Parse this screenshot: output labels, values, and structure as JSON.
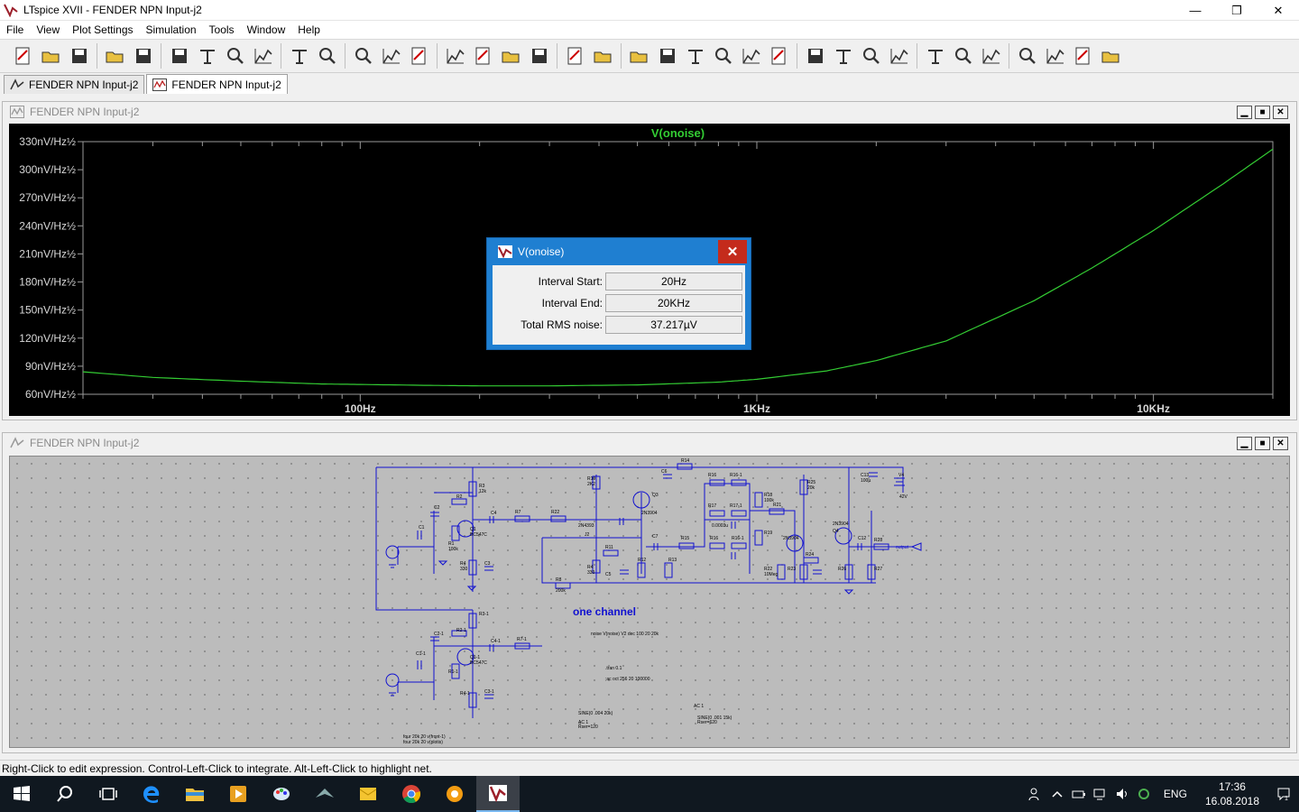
{
  "window": {
    "title": "LTspice XVII - FENDER NPN Input-j2",
    "minimize_glyph": "—",
    "restore_glyph": "❐",
    "close_glyph": "✕"
  },
  "menu": [
    "File",
    "View",
    "Plot Settings",
    "Simulation",
    "Tools",
    "Window",
    "Help"
  ],
  "toolbar_icons": [
    "new-schematic-icon",
    "open-icon",
    "save-icon",
    "control-panel-icon",
    "run-icon",
    "halt-icon",
    "zoom-in-icon",
    "zoom-full-icon",
    "zoom-out-icon",
    "zoom-cancel-icon",
    "autorange-icon",
    "plot-settings-icon",
    "tile-horizontal-icon",
    "cascade-icon",
    "tile-vertical-icon",
    "cut-icon",
    "copy-icon",
    "paste-icon",
    "find-icon",
    "print-icon",
    "print-setup-icon",
    "wire-icon",
    "ground-icon",
    "label-net-icon",
    "resistor-icon",
    "capacitor-icon",
    "inductor-icon",
    "diode-icon",
    "component-icon",
    "move-icon",
    "drag-icon",
    "undo-icon",
    "redo-icon",
    "rotate-icon",
    "mirror-icon",
    "text-icon",
    "spice-directive-icon"
  ],
  "tabs": [
    {
      "label": "FENDER NPN Input-j2",
      "kind": "schematic"
    },
    {
      "label": "FENDER NPN Input-j2",
      "kind": "waveform"
    }
  ],
  "waveform_window": {
    "title": "FENDER NPN Input-j2"
  },
  "schematic_window": {
    "title": "FENDER NPN Input-j2"
  },
  "chart_data": {
    "type": "line",
    "title": "V(onoise)",
    "x_scale": "log",
    "xlim": [
      20,
      20000
    ],
    "x_ticks": [
      {
        "value": 100,
        "label": "100Hz"
      },
      {
        "value": 1000,
        "label": "1KHz"
      },
      {
        "value": 10000,
        "label": "10KHz"
      }
    ],
    "ylim": [
      60,
      330
    ],
    "y_ticks": [
      {
        "value": 330,
        "label": "330nV/Hz½"
      },
      {
        "value": 300,
        "label": "300nV/Hz½"
      },
      {
        "value": 270,
        "label": "270nV/Hz½"
      },
      {
        "value": 240,
        "label": "240nV/Hz½"
      },
      {
        "value": 210,
        "label": "210nV/Hz½"
      },
      {
        "value": 180,
        "label": "180nV/Hz½"
      },
      {
        "value": 150,
        "label": "150nV/Hz½"
      },
      {
        "value": 120,
        "label": "120nV/Hz½"
      },
      {
        "value": 90,
        "label": "90nV/Hz½"
      },
      {
        "value": 60,
        "label": "60nV/Hz½"
      }
    ],
    "series": [
      {
        "name": "V(onoise)",
        "color": "#33cc33",
        "x": [
          20,
          30,
          50,
          80,
          100,
          150,
          200,
          300,
          500,
          800,
          1000,
          1500,
          2000,
          3000,
          5000,
          7000,
          10000,
          15000,
          20000
        ],
        "y": [
          84,
          78,
          74,
          71,
          70.5,
          69.5,
          69,
          69,
          70,
          73,
          76,
          85,
          96,
          117,
          160,
          195,
          235,
          285,
          322
        ]
      }
    ]
  },
  "dialog": {
    "title": "V(onoise)",
    "close_glyph": "✕",
    "interval_start_label": "Interval Start:",
    "interval_start_value": "20Hz",
    "interval_end_label": "Interval End:",
    "interval_end_value": "20KHz",
    "rms_label": "Total RMS noise:",
    "rms_value": "37.217µV"
  },
  "schematic": {
    "main_label": "one channel",
    "directive_noise": "noise V(noise) V2 dec 100 20 20k",
    "directive_tran": ".tran 0.1",
    "directive_ac": ";ac oct 256 20 100000",
    "directive_four": "four 20k 20 v(front-1)",
    "directive_four2": "four 20k 20 v(plotis)",
    "src1": "SINE(0 .004 20k)",
    "src1_ac": "AC 1",
    "src1_rser": "Rser=120",
    "src2": "SINE(0 .001 15k)",
    "src2_ac": "AC 1",
    "src2_rser": "Rser=620",
    "supply": "42V",
    "output_label": "output",
    "transistors": [
      "Q1",
      "Q1-1",
      "Q2",
      "Q3",
      "Q4"
    ],
    "part_labels": [
      "BC547C",
      "BC547C",
      "2N3904",
      "2N4393",
      "2N3904",
      "2N3904"
    ]
  },
  "status": "Right-Click to edit expression. Control-Left-Click to integrate. Alt-Left-Click to highlight net.",
  "taskbar": {
    "apps": [
      "start-icon",
      "search-icon",
      "task-view-icon",
      "edge-icon",
      "file-explorer-icon",
      "media-player-icon",
      "paint-icon",
      "gaming-icon",
      "folder-icon",
      "chrome-icon",
      "settings-icon",
      "ltspice-icon"
    ],
    "lang": "ENG",
    "time": "17:36",
    "date": "16.08.2018",
    "notification_count": "1"
  }
}
